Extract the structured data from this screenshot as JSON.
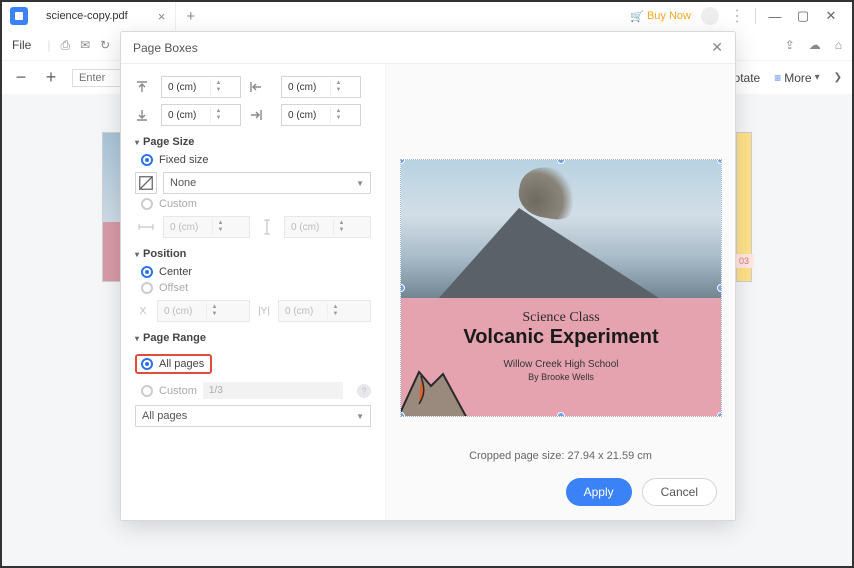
{
  "titlebar": {
    "filename": "science-copy.pdf",
    "buy_now": "Buy Now"
  },
  "topbar": {
    "file": "File",
    "rotate": "Rotate",
    "more": "More"
  },
  "secbar": {
    "search_placeholder": "Enter"
  },
  "thumbs": {
    "page_num": "03"
  },
  "modal": {
    "title": "Page Boxes",
    "margins": {
      "top": "0 (cm)",
      "left": "0 (cm)",
      "bottom": "0 (cm)",
      "right": "0 (cm)"
    },
    "page_size": {
      "heading": "Page Size",
      "fixed_label": "Fixed size",
      "custom_label": "Custom",
      "preset_value": "None",
      "w_value": "0 (cm)",
      "h_value": "0 (cm)"
    },
    "position": {
      "heading": "Position",
      "center_label": "Center",
      "offset_label": "Offset",
      "x_value": "0 (cm)",
      "y_value": "0 (cm)",
      "x_label": "X",
      "y_label": "|Y|"
    },
    "page_range": {
      "heading": "Page Range",
      "all_pages": "All pages",
      "custom_label": "Custom",
      "custom_value": "1/3",
      "dropdown": "All pages"
    },
    "preview": {
      "title1": "Science Class",
      "title2": "Volcanic Experiment",
      "school": "Willow Creek High School",
      "author": "By Brooke Wells",
      "cropped_size": "Cropped page size: 27.94 x 21.59 cm"
    },
    "buttons": {
      "apply": "Apply",
      "cancel": "Cancel"
    }
  }
}
